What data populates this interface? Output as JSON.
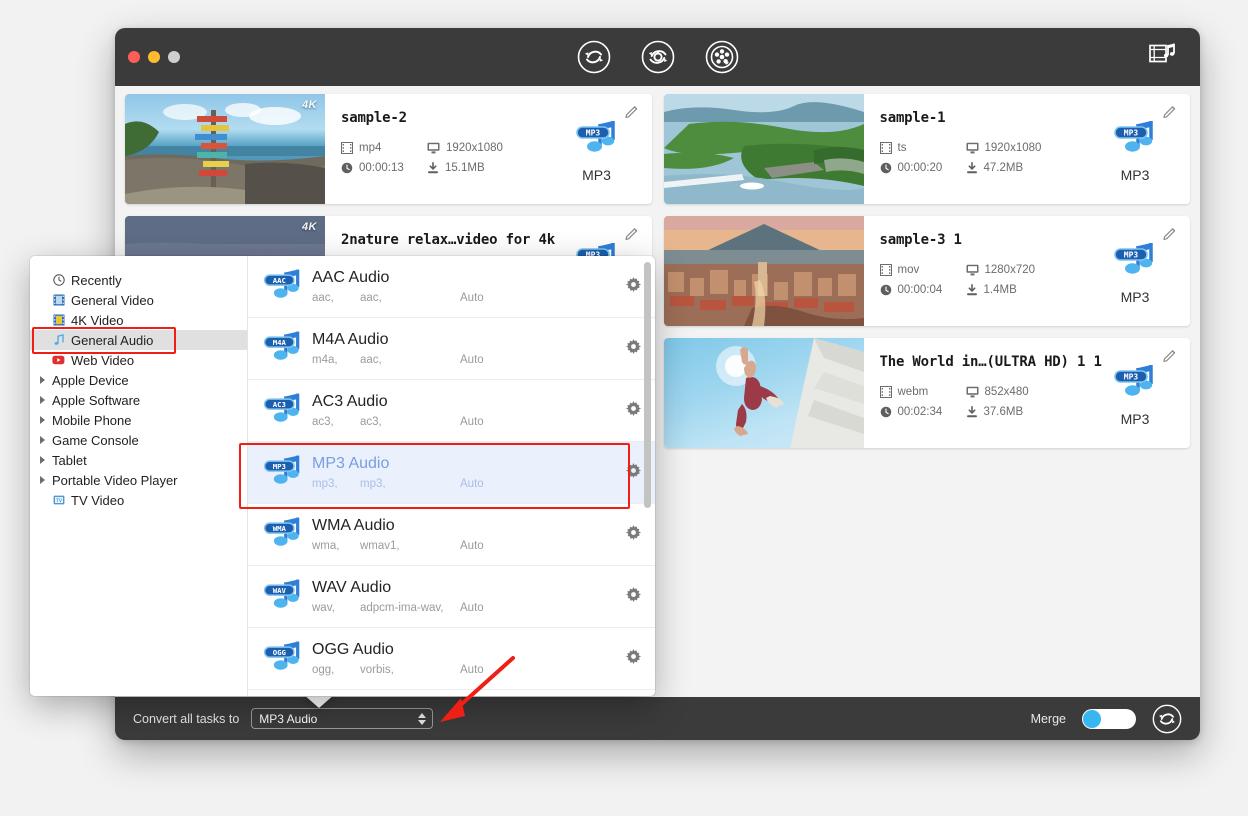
{
  "window": {
    "traffic_lights": [
      "close",
      "minimize",
      "maximize"
    ],
    "toolbar": {
      "convert_label": "Convert",
      "toolbox_label": "Toolbox",
      "downloader_label": "Downloader",
      "media_library_label": "Media Library"
    }
  },
  "files": {
    "left": [
      {
        "title": "sample-2",
        "container": "mp4",
        "resolution": "1920x1080",
        "duration": "00:00:13",
        "size": "15.1MB",
        "output_format": "MP3",
        "badge": "4K",
        "thumbnail": "beach-signpost"
      },
      {
        "title": "2nature relax…video for 4k",
        "container": "",
        "resolution": "",
        "duration": "",
        "size": "",
        "output_format": "MP3",
        "badge": "4K",
        "thumbnail": "pink-flower-field"
      }
    ],
    "right": [
      {
        "title": "sample-1",
        "container": "ts",
        "resolution": "1920x1080",
        "duration": "00:00:20",
        "size": "47.2MB",
        "output_format": "MP3",
        "badge": "",
        "thumbnail": "lake-island-aerial"
      },
      {
        "title": "sample-3 1",
        "container": "mov",
        "resolution": "1280x720",
        "duration": "00:00:04",
        "size": "1.4MB",
        "output_format": "MP3",
        "badge": "",
        "thumbnail": "city-volcano-sunset"
      },
      {
        "title": "The World in…(ULTRA HD) 1 1",
        "container": "webm",
        "resolution": "852x480",
        "duration": "00:02:34",
        "size": "37.6MB",
        "output_format": "MP3",
        "badge": "",
        "thumbnail": "skydiver-blue-sky"
      }
    ]
  },
  "bottom_bar": {
    "convert_all_label": "Convert all tasks to",
    "selected_format": "MP3 Audio",
    "merge_label": "Merge",
    "merge_on": false,
    "convert_button_label": "Convert"
  },
  "format_popup": {
    "categories": [
      {
        "label": "Recently",
        "icon": "clock-icon",
        "expandable": false,
        "selected": false
      },
      {
        "label": "General Video",
        "icon": "film-blue-icon",
        "expandable": false,
        "selected": false
      },
      {
        "label": "4K Video",
        "icon": "film-4k-icon",
        "expandable": false,
        "selected": false
      },
      {
        "label": "General Audio",
        "icon": "note-blue-icon",
        "expandable": false,
        "selected": true
      },
      {
        "label": "Web Video",
        "icon": "youtube-icon",
        "expandable": false,
        "selected": false
      },
      {
        "label": "Apple Device",
        "icon": "",
        "expandable": true,
        "selected": false
      },
      {
        "label": "Apple Software",
        "icon": "",
        "expandable": true,
        "selected": false
      },
      {
        "label": "Mobile Phone",
        "icon": "",
        "expandable": true,
        "selected": false
      },
      {
        "label": "Game Console",
        "icon": "",
        "expandable": true,
        "selected": false
      },
      {
        "label": "Tablet",
        "icon": "",
        "expandable": true,
        "selected": false
      },
      {
        "label": "Portable Video Player",
        "icon": "",
        "expandable": true,
        "selected": false
      },
      {
        "label": "TV Video",
        "icon": "tv-icon",
        "expandable": false,
        "selected": false
      }
    ],
    "formats": [
      {
        "name": "AAC Audio",
        "badge": "AAC",
        "ext": "aac,",
        "codec": "aac,",
        "quality": "Auto",
        "active": false
      },
      {
        "name": "M4A Audio",
        "badge": "M4A",
        "ext": "m4a,",
        "codec": "aac,",
        "quality": "Auto",
        "active": false
      },
      {
        "name": "AC3 Audio",
        "badge": "AC3",
        "ext": "ac3,",
        "codec": "ac3,",
        "quality": "Auto",
        "active": false
      },
      {
        "name": "MP3 Audio",
        "badge": "MP3",
        "ext": "mp3,",
        "codec": "mp3,",
        "quality": "Auto",
        "active": true
      },
      {
        "name": "WMA Audio",
        "badge": "WMA",
        "ext": "wma,",
        "codec": "wmav1,",
        "quality": "Auto",
        "active": false
      },
      {
        "name": "WAV Audio",
        "badge": "WAV",
        "ext": "wav,",
        "codec": "adpcm-ima-wav,",
        "quality": "Auto",
        "active": false
      },
      {
        "name": "OGG Audio",
        "badge": "OGG",
        "ext": "ogg,",
        "codec": "vorbis,",
        "quality": "Auto",
        "active": false
      }
    ],
    "settings_icon": "gear-icon"
  },
  "annotations": {
    "highlight_sidebar_item": "General Audio",
    "highlight_format_row": "MP3 Audio",
    "pointer_target": "format-select-dropdown",
    "color": "#f01f16"
  }
}
